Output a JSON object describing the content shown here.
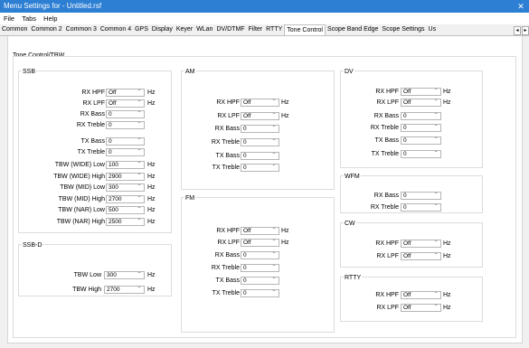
{
  "window": {
    "title": "Menu Settings for  - Untitled.rsf",
    "close_glyph": "✕"
  },
  "menu": [
    "File",
    "Tabs",
    "Help"
  ],
  "tabs": [
    "Common",
    "Common 2",
    "Common 3",
    "Common 4",
    "GPS",
    "Display",
    "Keyer",
    "WLan",
    "DV/DTMF",
    "Filter",
    "RTTY",
    "Tone Control",
    "Scope Band Edge",
    "Scope Settings",
    "Us"
  ],
  "active_tab": "Tone Control",
  "tab_scroll": [
    "◂",
    "▸"
  ],
  "panel_title": "Tone Control/TBW",
  "unit": "Hz",
  "dropdown_arrow": "﹀",
  "groups": {
    "ssb": {
      "title": "SSB",
      "rows": [
        {
          "label": "RX HPF",
          "value": "Off",
          "hz": true
        },
        {
          "label": "RX LPF",
          "value": "Off",
          "hz": true
        },
        {
          "label": "RX Bass",
          "value": "0",
          "hz": false
        },
        {
          "label": "RX Treble",
          "value": "0",
          "hz": false
        },
        {
          "label": "TX Bass",
          "value": "0",
          "hz": false
        },
        {
          "label": "TX Treble",
          "value": "0",
          "hz": false
        },
        {
          "label": "TBW (WIDE) Low",
          "value": "100",
          "hz": true
        },
        {
          "label": "TBW (WIDE) High",
          "value": "2900",
          "hz": true
        },
        {
          "label": "TBW (MID) Low",
          "value": "300",
          "hz": true
        },
        {
          "label": "TBW (MID) High",
          "value": "2700",
          "hz": true
        },
        {
          "label": "TBW (NAR) Low",
          "value": "500",
          "hz": true
        },
        {
          "label": "TBW (NAR) High",
          "value": "2500",
          "hz": true
        }
      ]
    },
    "ssbd": {
      "title": "SSB-D",
      "rows": [
        {
          "label": "TBW Low",
          "value": "300",
          "hz": true
        },
        {
          "label": "TBW High",
          "value": "2700",
          "hz": true
        }
      ]
    },
    "am": {
      "title": "AM",
      "rows": [
        {
          "label": "RX HPF",
          "value": "Off",
          "hz": true
        },
        {
          "label": "RX LPF",
          "value": "Off",
          "hz": true
        },
        {
          "label": "RX Bass",
          "value": "0",
          "hz": false
        },
        {
          "label": "RX Treble",
          "value": "0",
          "hz": false
        },
        {
          "label": "TX Bass",
          "value": "0",
          "hz": false
        },
        {
          "label": "TX Treble",
          "value": "0",
          "hz": false
        }
      ]
    },
    "fm": {
      "title": "FM",
      "rows": [
        {
          "label": "RX HPF",
          "value": "Off",
          "hz": true
        },
        {
          "label": "RX LPF",
          "value": "Off",
          "hz": true
        },
        {
          "label": "RX Bass",
          "value": "0",
          "hz": false
        },
        {
          "label": "RX Treble",
          "value": "0",
          "hz": false
        },
        {
          "label": "TX Bass",
          "value": "0",
          "hz": false
        },
        {
          "label": "TX Treble",
          "value": "0",
          "hz": false
        }
      ]
    },
    "dv": {
      "title": "DV",
      "rows": [
        {
          "label": "RX HPF",
          "value": "Off",
          "hz": true
        },
        {
          "label": "RX LPF",
          "value": "Off",
          "hz": true
        },
        {
          "label": "RX Bass",
          "value": "0",
          "hz": false
        },
        {
          "label": "RX Treble",
          "value": "0",
          "hz": false
        },
        {
          "label": "TX Bass",
          "value": "0",
          "hz": false
        },
        {
          "label": "TX Treble",
          "value": "0",
          "hz": false
        }
      ]
    },
    "wfm": {
      "title": "WFM",
      "rows": [
        {
          "label": "RX Bass",
          "value": "0",
          "hz": false
        },
        {
          "label": "RX Treble",
          "value": "0",
          "hz": false
        }
      ]
    },
    "cw": {
      "title": "CW",
      "rows": [
        {
          "label": "RX HPF",
          "value": "Off",
          "hz": true
        },
        {
          "label": "RX LPF",
          "value": "Off",
          "hz": true
        }
      ]
    },
    "rtty": {
      "title": "RTTY",
      "rows": [
        {
          "label": "RX HPF",
          "value": "Off",
          "hz": true
        },
        {
          "label": "RX LPF",
          "value": "Off",
          "hz": true
        }
      ]
    }
  }
}
